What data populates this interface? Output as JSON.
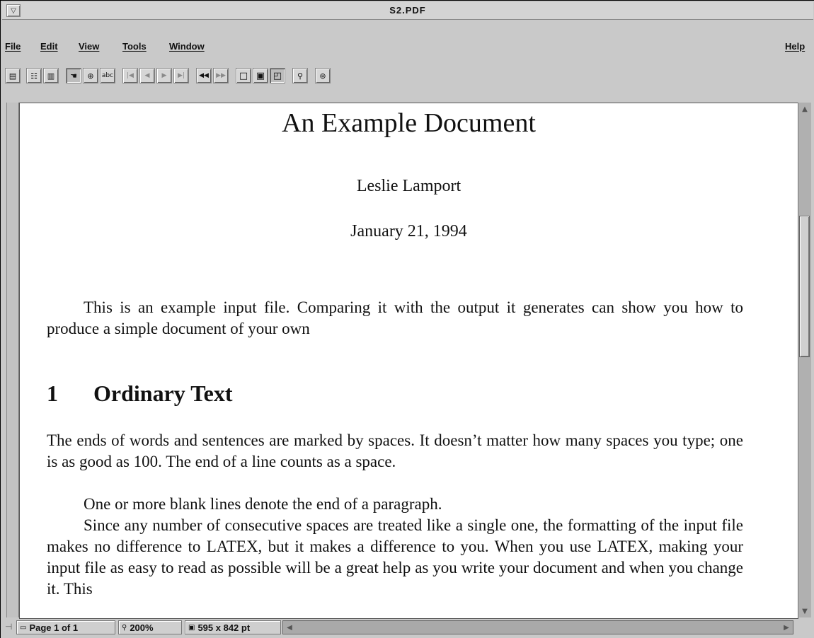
{
  "window": {
    "title": "S2.PDF",
    "menu_button_icon": "dropdown-triangle-icon"
  },
  "menubar": {
    "items": [
      "File",
      "Edit",
      "View",
      "Tools",
      "Window"
    ],
    "help": "Help"
  },
  "toolbar": {
    "buttons": [
      {
        "icon": "page-only-view-icon",
        "glyph": "▤",
        "state": "normal"
      },
      {
        "icon": "bookmarks-view-icon",
        "glyph": "☷",
        "state": "normal"
      },
      {
        "icon": "thumbnails-view-icon",
        "glyph": "▥",
        "state": "normal"
      },
      {
        "icon": "hand-tool-icon",
        "glyph": "☚",
        "state": "pressed"
      },
      {
        "icon": "zoom-in-icon",
        "glyph": "⊕",
        "state": "normal"
      },
      {
        "icon": "text-select-icon",
        "glyph": "abc",
        "state": "normal"
      },
      {
        "icon": "first-page-icon",
        "glyph": "|◀",
        "state": "disabled"
      },
      {
        "icon": "previous-page-icon",
        "glyph": "◀",
        "state": "disabled"
      },
      {
        "icon": "next-page-icon",
        "glyph": "▶",
        "state": "disabled"
      },
      {
        "icon": "last-page-icon",
        "glyph": "▶|",
        "state": "disabled"
      },
      {
        "icon": "go-back-icon",
        "glyph": "◀◀",
        "state": "bold"
      },
      {
        "icon": "go-forward-icon",
        "glyph": "▶▶",
        "state": "disabled"
      },
      {
        "icon": "actual-size-icon",
        "glyph": "□",
        "state": "bold"
      },
      {
        "icon": "fit-page-icon",
        "glyph": "▣",
        "state": "bold"
      },
      {
        "icon": "fit-width-icon",
        "glyph": "◰",
        "state": "bold"
      },
      {
        "icon": "find-binoculars-icon",
        "glyph": "⚲",
        "state": "normal"
      },
      {
        "icon": "acrobat-logo-icon",
        "glyph": "⊛",
        "state": "normal"
      }
    ]
  },
  "document": {
    "title": "An Example Document",
    "author": "Leslie Lamport",
    "date": "January 21, 1994",
    "abstract": "This is an example input file. Comparing it with the output it generates can show you how to produce a simple document of your own",
    "section_number": "1",
    "section_title": "Ordinary Text",
    "para1": "The ends of words and sentences are marked by spaces. It doesn’t matter how many spaces you type; one is as good as 100. The end of a line counts as a space.",
    "para2": "One or more blank lines denote the end of a paragraph.",
    "para3": "Since any number of consecutive spaces are treated like a single one, the formatting of the input file makes no difference to LATEX, but it makes a difference to you. When you use LATEX, making your input file as easy to read as possible will be a great help as you write your document and when you change it. This"
  },
  "statusbar": {
    "page": "Page 1 of 1",
    "zoom": "200%",
    "size": "595 x 842 pt"
  }
}
